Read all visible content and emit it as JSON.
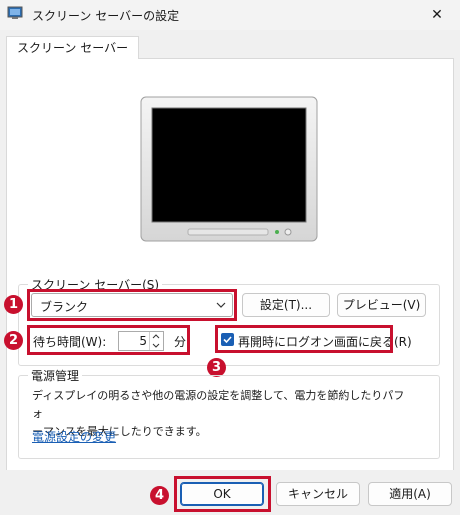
{
  "window": {
    "title": "スクリーン セーバーの設定",
    "close_glyph": "✕"
  },
  "tab": {
    "label": "スクリーン セーバー"
  },
  "screensaver": {
    "group_label": "スクリーン セーバー(S)",
    "selected": "ブランク",
    "settings_button": "設定(T)...",
    "preview_button": "プレビュー(V)",
    "wait_label": "待ち時間(W):",
    "wait_value": "5",
    "wait_unit": "分",
    "resume_label": "再開時にログオン画面に戻る(R)",
    "resume_checked": true
  },
  "power": {
    "group_label": "電源管理",
    "description_line1": "ディスプレイの明るさや他の電源の設定を調整して、電力を節約したりパフォ",
    "description_line2": "ーマンスを最大にしたりできます。",
    "link": "電源設定の変更"
  },
  "buttons": {
    "ok": "OK",
    "cancel": "キャンセル",
    "apply": "適用(A)"
  },
  "annotations": {
    "badge1": "1",
    "badge2": "2",
    "badge3": "3",
    "badge4": "4",
    "color": "#c8102e"
  },
  "icons": [
    "app-screen-icon",
    "close-icon",
    "chevron-down-icon",
    "spin-up-icon",
    "spin-down-icon",
    "checkmark-icon"
  ]
}
